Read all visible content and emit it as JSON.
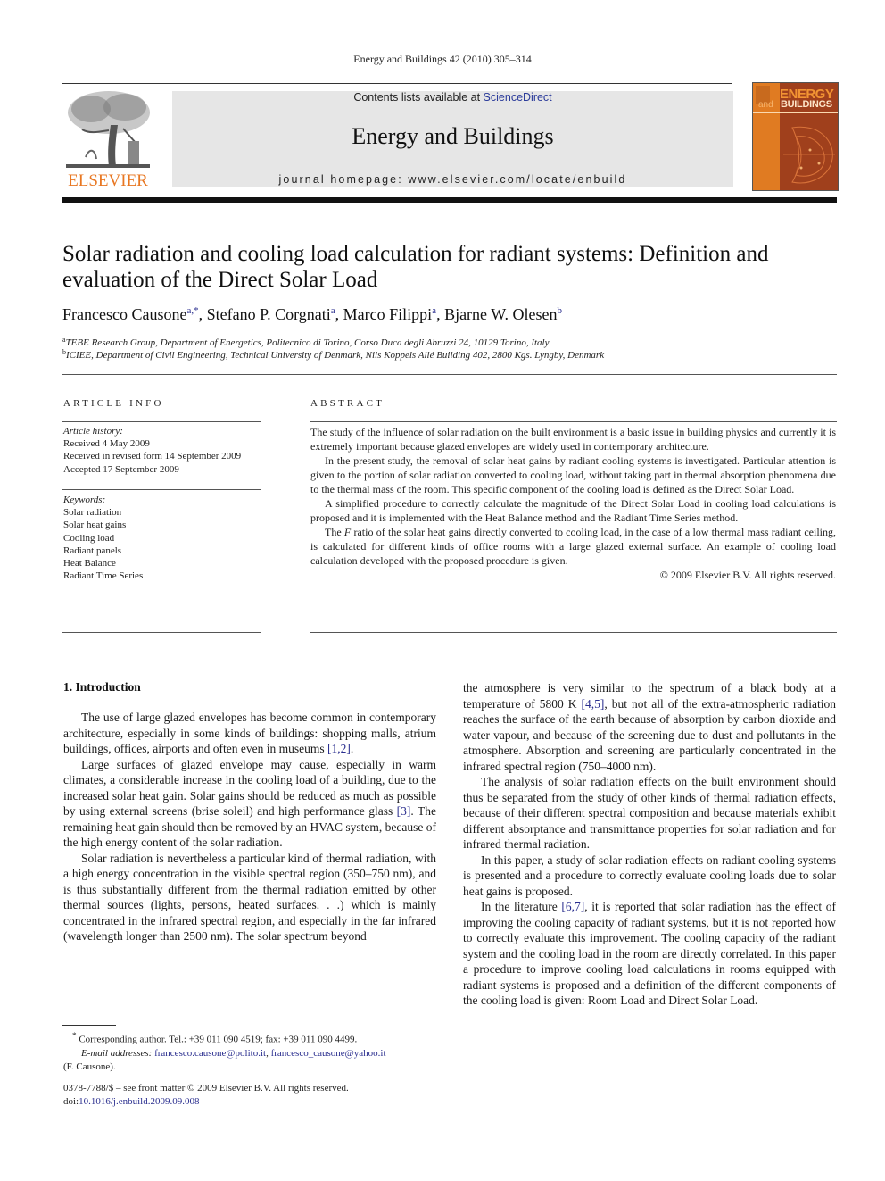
{
  "running_head": "Energy and Buildings 42 (2010) 305–314",
  "publisher": {
    "logo_word": "ELSEVIER",
    "logo_color": "#e87722"
  },
  "masthead": {
    "contents_prefix": "Contents lists available at ",
    "contents_link": "ScienceDirect",
    "journal_name": "Energy and Buildings",
    "homepage_prefix": "journal homepage: ",
    "homepage_url": "www.elsevier.com/locate/enbuild"
  },
  "cover": {
    "word1": "ENERGY",
    "word2": "and",
    "word3": "BUILDINGS",
    "bg_color": "#e07b22",
    "panel_color": "#a0401c"
  },
  "article": {
    "title": "Solar radiation and cooling load calculation for radiant systems: Definition and evaluation of the Direct Solar Load",
    "authors": [
      {
        "name": "Francesco Causone",
        "sup": "a,*"
      },
      {
        "name": "Stefano P. Corgnati",
        "sup": "a"
      },
      {
        "name": "Marco Filippi",
        "sup": "a"
      },
      {
        "name": "Bjarne W. Olesen",
        "sup": "b"
      }
    ],
    "affiliations": [
      {
        "key": "a",
        "text": "TEBE Research Group, Department of Energetics, Politecnico di Torino, Corso Duca degli Abruzzi 24, 10129 Torino, Italy"
      },
      {
        "key": "b",
        "text": "ICIEE, Department of Civil Engineering, Technical University of Denmark, Nils Koppels Allé Building 402, 2800 Kgs. Lyngby, Denmark"
      }
    ]
  },
  "article_info": {
    "heading": "ARTICLE INFO",
    "history_label": "Article history:",
    "history": [
      "Received 4 May 2009",
      "Received in revised form 14 September 2009",
      "Accepted 17 September 2009"
    ],
    "keywords_label": "Keywords:",
    "keywords": [
      "Solar radiation",
      "Solar heat gains",
      "Cooling load",
      "Radiant panels",
      "Heat Balance",
      "Radiant Time Series"
    ]
  },
  "abstract": {
    "heading": "ABSTRACT",
    "paragraphs": [
      "The study of the influence of solar radiation on the built environment is a basic issue in building physics and currently it is extremely important because glazed envelopes are widely used in contemporary architecture.",
      "In the present study, the removal of solar heat gains by radiant cooling systems is investigated. Particular attention is given to the portion of solar radiation converted to cooling load, without taking part in thermal absorption phenomena due to the thermal mass of the room. This specific component of the cooling load is defined as the Direct Solar Load.",
      "A simplified procedure to correctly calculate the magnitude of the Direct Solar Load in cooling load calculations is proposed and it is implemented with the Heat Balance method and the Radiant Time Series method."
    ],
    "p4_pre": "The ",
    "p4_italic": "F",
    "p4_post": " ratio of the solar heat gains directly converted to cooling load, in the case of a low thermal mass radiant ceiling, is calculated for different kinds of office rooms with a large glazed external surface. An example of cooling load calculation developed with the proposed procedure is given.",
    "copyright": "© 2009 Elsevier B.V. All rights reserved."
  },
  "body": {
    "section_heading": "1.  Introduction",
    "left": {
      "p1_text": "The use of large glazed envelopes has become common in contemporary architecture, especially in some kinds of buildings: shopping malls, atrium buildings, offices, airports and often even in museums ",
      "p1_ref": "[1,2]",
      "p1_end": ".",
      "p2_text": "Large surfaces of glazed envelope may cause, especially in warm climates, a considerable increase in the cooling load of a building, due to the increased solar heat gain. Solar gains should be reduced as much as possible by using external screens (brise soleil) and high performance glass ",
      "p2_ref": "[3]",
      "p2_end": ". The remaining heat gain should then be removed by an HVAC system, because of the high energy content of the solar radiation.",
      "p3_text": "Solar radiation is nevertheless a particular kind of thermal radiation, with a high energy concentration in the visible spectral region (350–750 nm), and is thus substantially different from the thermal radiation emitted by other thermal sources (lights, persons, heated surfaces. . .) which is mainly concentrated in the infrared spectral region, and especially in the far infrared (wavelength longer than 2500 nm). The solar spectrum beyond"
    },
    "right": {
      "p1_text": "the atmosphere is very similar to the spectrum of a black body at a temperature of 5800 K ",
      "p1_ref": "[4,5]",
      "p1_end": ", but not all of the extra-atmospheric radiation reaches the surface of the earth because of absorption by carbon dioxide and water vapour, and because of the screening due to dust and pollutants in the atmosphere. Absorption and screening are particularly concentrated in the infrared spectral region (750–4000 nm).",
      "p2_text": "The analysis of solar radiation effects on the built environment should thus be separated from the study of other kinds of thermal radiation effects, because of their different spectral composition and because materials exhibit different absorptance and transmittance properties for solar radiation and for infrared thermal radiation.",
      "p3_text": "In this paper, a study of solar radiation effects on radiant cooling systems is presented and a procedure to correctly evaluate cooling loads due to solar heat gains is proposed.",
      "p4_text": "In the literature ",
      "p4_ref": "[6,7]",
      "p4_end": ", it is reported that solar radiation has the effect of improving the cooling capacity of radiant systems, but it is not reported how to correctly evaluate this improvement. The cooling capacity of the radiant system and the cooling load in the room are directly correlated. In this paper a procedure to improve cooling load calculations in rooms equipped with radiant systems is proposed and a definition of the different components of the cooling load is given: Room Load and Direct Solar Load."
    }
  },
  "footnote": {
    "marker": "*",
    "corresponding": "Corresponding author. Tel.: +39 011 090 4519; fax: +39 011 090 4499.",
    "email_label": "E-mail addresses:",
    "email1": "francesco.causone@polito.it",
    "email_sep": ", ",
    "email2": "francesco_causone@yahoo.it",
    "name": "(F. Causone)."
  },
  "front_matter": {
    "issn_line": "0378-7788/$ – see front matter © 2009 Elsevier B.V. All rights reserved.",
    "doi_prefix": "doi:",
    "doi": "10.1016/j.enbuild.2009.09.008"
  }
}
